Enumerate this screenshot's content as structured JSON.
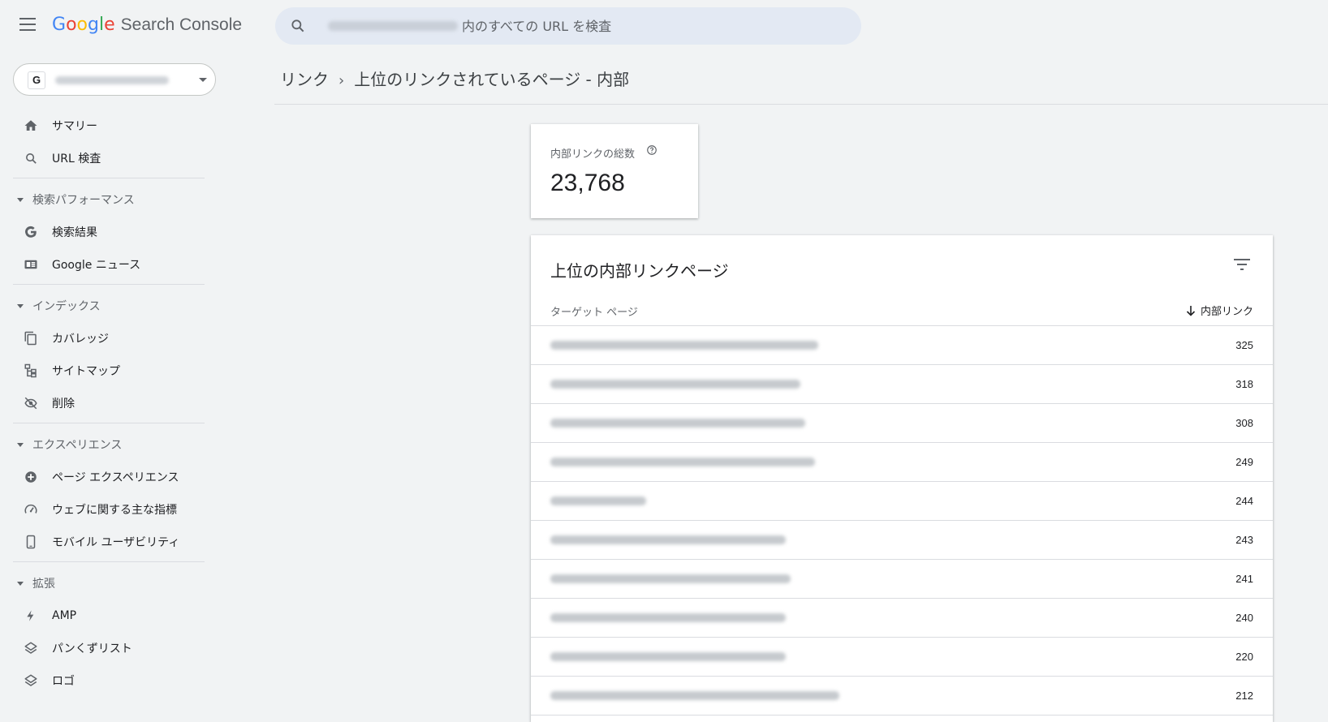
{
  "app": {
    "logo_google": "Google",
    "logo_product": "Search Console"
  },
  "search": {
    "placeholder": "内のすべての URL を検査"
  },
  "property": {
    "badge": "G"
  },
  "sidebar": {
    "top_items": [
      {
        "label": "サマリー",
        "icon": "home-icon"
      },
      {
        "label": "URL 検査",
        "icon": "search-icon"
      }
    ],
    "sections": [
      {
        "title": "検索パフォーマンス",
        "items": [
          {
            "label": "検索結果",
            "icon": "google-g-icon"
          },
          {
            "label": "Google ニュース",
            "icon": "google-news-icon"
          }
        ]
      },
      {
        "title": "インデックス",
        "items": [
          {
            "label": "カバレッジ",
            "icon": "coverage-icon"
          },
          {
            "label": "サイトマップ",
            "icon": "sitemap-icon"
          },
          {
            "label": "削除",
            "icon": "removal-eye-icon"
          }
        ]
      },
      {
        "title": "エクスペリエンス",
        "items": [
          {
            "label": "ページ エクスペリエンス",
            "icon": "page-experience-icon"
          },
          {
            "label": "ウェブに関する主な指標",
            "icon": "speedometer-icon"
          },
          {
            "label": "モバイル ユーザビリティ",
            "icon": "mobile-icon"
          }
        ]
      },
      {
        "title": "拡張",
        "items": [
          {
            "label": "AMP",
            "icon": "lightning-icon"
          },
          {
            "label": "パンくずリスト",
            "icon": "layers-icon"
          },
          {
            "label": "ロゴ",
            "icon": "layers-icon"
          }
        ]
      }
    ]
  },
  "breadcrumb": {
    "parent": "リンク",
    "separator": "›",
    "current": "上位のリンクされているページ - 内部"
  },
  "stat": {
    "label": "内部リンクの総数",
    "value": "23,768"
  },
  "table": {
    "title": "上位の内部リンクページ",
    "col_target": "ターゲット ページ",
    "col_links": "内部リンク",
    "rows": [
      {
        "count": "325"
      },
      {
        "count": "318"
      },
      {
        "count": "308"
      },
      {
        "count": "249"
      },
      {
        "count": "244"
      },
      {
        "count": "243"
      },
      {
        "count": "241"
      },
      {
        "count": "240"
      },
      {
        "count": "220"
      },
      {
        "count": "212"
      }
    ]
  },
  "colors": {
    "google_blue": "#4285f4",
    "google_red": "#ea4335",
    "google_yellow": "#fbbc05",
    "google_green": "#34a853",
    "search_bg": "#e3e9f3",
    "page_bg": "#f1f3f4"
  }
}
